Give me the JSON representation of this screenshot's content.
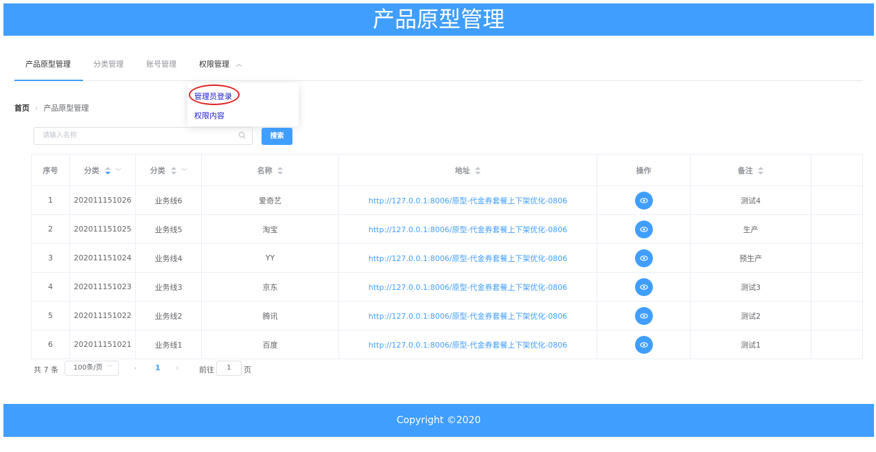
{
  "header": {
    "title": "产品原型管理"
  },
  "nav": {
    "tabs": [
      {
        "label": "产品原型管理"
      },
      {
        "label": "分类管理"
      },
      {
        "label": "账号管理"
      },
      {
        "label": "权限管理"
      }
    ],
    "dropdown": [
      {
        "label": "管理员登录"
      },
      {
        "label": "权限内容"
      }
    ]
  },
  "breadcrumb": {
    "home": "首页",
    "current": "产品原型管理"
  },
  "search": {
    "placeholder": "请输入名称",
    "button": "搜索"
  },
  "table": {
    "headers": [
      "序号",
      "分类",
      "分类",
      "名称",
      "地址",
      "操作",
      "备注"
    ],
    "rows": [
      {
        "idx": "1",
        "code": "202011151026",
        "line": "业务线6",
        "name": "爱奇艺",
        "url": "http://127.0.0.1:8006/原型-代金券套餐上下架优化-0806",
        "note": "测试4"
      },
      {
        "idx": "2",
        "code": "202011151025",
        "line": "业务线5",
        "name": "淘宝",
        "url": "http://127.0.0.1:8006/原型-代金券套餐上下架优化-0806",
        "note": "生产"
      },
      {
        "idx": "3",
        "code": "202011151024",
        "line": "业务线4",
        "name": "YY",
        "url": "http://127.0.0.1:8006/原型-代金券套餐上下架优化-0806",
        "note": "预生产"
      },
      {
        "idx": "4",
        "code": "202011151023",
        "line": "业务线3",
        "name": "京东",
        "url": "http://127.0.0.1:8006/原型-代金券套餐上下架优化-0806",
        "note": "测试3"
      },
      {
        "idx": "5",
        "code": "202011151022",
        "line": "业务线2",
        "name": "腾讯",
        "url": "http://127.0.0.1:8006/原型-代金券套餐上下架优化-0806",
        "note": "测试2"
      },
      {
        "idx": "6",
        "code": "202011151021",
        "line": "业务线1",
        "name": "百度",
        "url": "http://127.0.0.1:8006/原型-代金券套餐上下架优化-0806",
        "note": "测试1"
      }
    ]
  },
  "pager": {
    "total": "共 7 条",
    "size": "100条/页",
    "current": "1",
    "goto": "前往",
    "goto_value": "1",
    "page": "页"
  },
  "footer": {
    "text": "Copyright ©2020"
  },
  "colors": {
    "primary": "#409eff",
    "annotation": "#e02020",
    "dropdown_text": "#1b1bd0"
  }
}
